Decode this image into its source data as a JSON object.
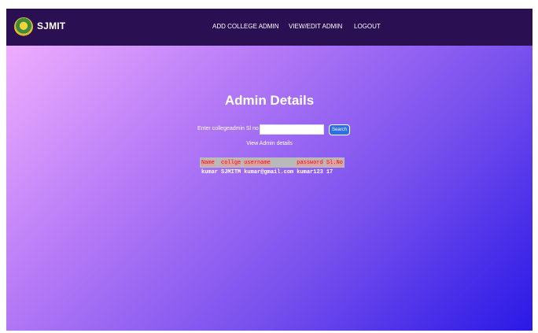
{
  "brand": {
    "name": "SJMIT",
    "logo_icon": "college-emblem-icon"
  },
  "nav": {
    "add_admin": "ADD COLLEGE ADMIN",
    "view_edit_admin": "VIEW/EDIT ADMIN",
    "logout": "LOGOUT"
  },
  "main": {
    "title": "Admin Details",
    "search_label": "Enter collegeadmin Sl no",
    "search_value": "",
    "search_button": "Search",
    "view_link": "View Admin details"
  },
  "table": {
    "headers": [
      "Name",
      "collge",
      "username",
      "password",
      "Sl.No"
    ],
    "rows": [
      [
        "kumar",
        "SJMITM",
        "kumar@gmail.com",
        "kumar123",
        "17"
      ]
    ]
  },
  "colors": {
    "navbar": "#2a0f52",
    "gradient_start": "#f6b4ff",
    "gradient_end": "#2a18e6",
    "header_text": "#d42020",
    "search_button": "#2f6fe4"
  }
}
